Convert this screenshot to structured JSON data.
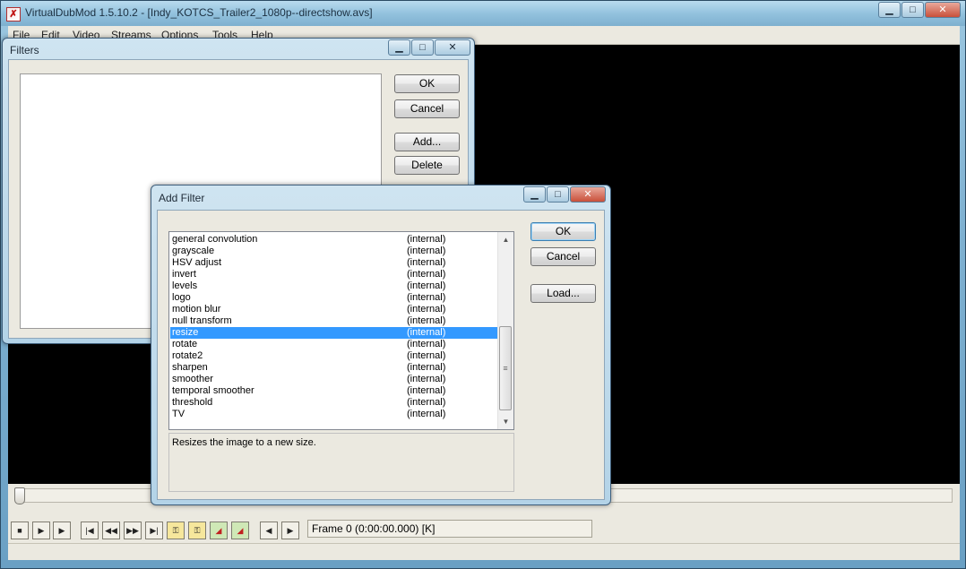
{
  "main_window": {
    "title": "VirtualDubMod 1.5.10.2 - [Indy_KOTCS_Trailer2_1080p--directshow.avs]",
    "controls": {
      "minimize": "▁",
      "maximize": "□",
      "close": "✕"
    },
    "menu": [
      "File",
      "Edit",
      "Video",
      "Streams",
      "Options",
      "Tools",
      "Help"
    ],
    "frame_status": "Frame 0 (0:00:00.000) [K]",
    "toolbar_icons": [
      "stop-icon",
      "play-input-icon",
      "play-output-icon",
      "start-icon",
      "prev-icon",
      "next-icon",
      "end-icon",
      "prev-key-icon",
      "next-key-icon",
      "scene-prev-icon",
      "scene-next-icon",
      "mark-in-icon",
      "mark-out-icon"
    ],
    "toolbar_glyphs": [
      "■",
      "▶",
      "▶",
      "|◀",
      "◀◀",
      "▶▶",
      "▶|",
      "⚿",
      "⚿",
      "◢",
      "◢",
      "◀",
      "▶"
    ]
  },
  "filters_dialog": {
    "title": "Filters",
    "controls": {
      "minimize": "▁",
      "maximize": "□",
      "close": "✕"
    },
    "buttons": {
      "ok": "OK",
      "cancel": "Cancel",
      "add": "Add...",
      "delete": "Delete"
    }
  },
  "add_filter_dialog": {
    "title": "Add Filter",
    "controls": {
      "minimize": "▁",
      "maximize": "□",
      "close": "✕"
    },
    "buttons": {
      "ok": "OK",
      "cancel": "Cancel",
      "load": "Load..."
    },
    "filters": [
      {
        "name": "general convolution",
        "type": "(internal)"
      },
      {
        "name": "grayscale",
        "type": "(internal)"
      },
      {
        "name": "HSV adjust",
        "type": "(internal)"
      },
      {
        "name": "invert",
        "type": "(internal)"
      },
      {
        "name": "levels",
        "type": "(internal)"
      },
      {
        "name": "logo",
        "type": "(internal)"
      },
      {
        "name": "motion blur",
        "type": "(internal)"
      },
      {
        "name": "null transform",
        "type": "(internal)"
      },
      {
        "name": "resize",
        "type": "(internal)"
      },
      {
        "name": "rotate",
        "type": "(internal)"
      },
      {
        "name": "rotate2",
        "type": "(internal)"
      },
      {
        "name": "sharpen",
        "type": "(internal)"
      },
      {
        "name": "smoother",
        "type": "(internal)"
      },
      {
        "name": "temporal smoother",
        "type": "(internal)"
      },
      {
        "name": "threshold",
        "type": "(internal)"
      },
      {
        "name": "TV",
        "type": "(internal)"
      }
    ],
    "selected_filter": "resize",
    "description": "Resizes the image to a new size."
  }
}
